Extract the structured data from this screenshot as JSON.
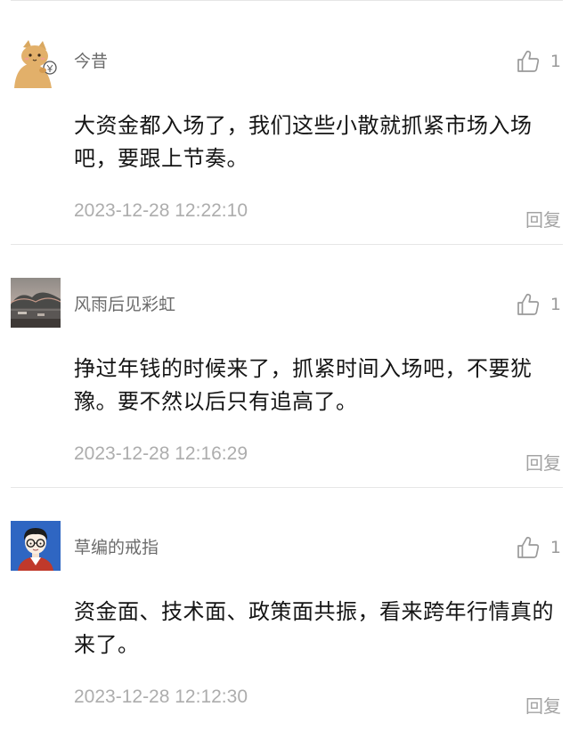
{
  "comments": [
    {
      "username": "今昔",
      "text": "大资金都入场了，我们这些小散就抓紧市场入场吧，要跟上节奏。",
      "timestamp": "2023-12-28 12:22:10",
      "likes": "1",
      "reply_label": "回复",
      "avatar_icon": "cartoon-cat-avatar"
    },
    {
      "username": "风雨后见彩虹",
      "text": "挣过年钱的时候来了，抓紧时间入场吧，不要犹豫。要不然以后只有追高了。",
      "timestamp": "2023-12-28 12:16:29",
      "likes": "1",
      "reply_label": "回复",
      "avatar_icon": "lake-landscape-avatar"
    },
    {
      "username": "草编的戒指",
      "text": "资金面、技术面、政策面共振，看来跨年行情真的来了。",
      "timestamp": "2023-12-28 12:12:30",
      "likes": "1",
      "reply_label": "回复",
      "avatar_icon": "cartoon-glasses-boy-avatar"
    }
  ],
  "colors": {
    "username": "#6b6b6b",
    "body_text": "#151515",
    "timestamp": "#adadad",
    "divider": "#e6e6e6",
    "like_icon": "#9a9a9a"
  }
}
